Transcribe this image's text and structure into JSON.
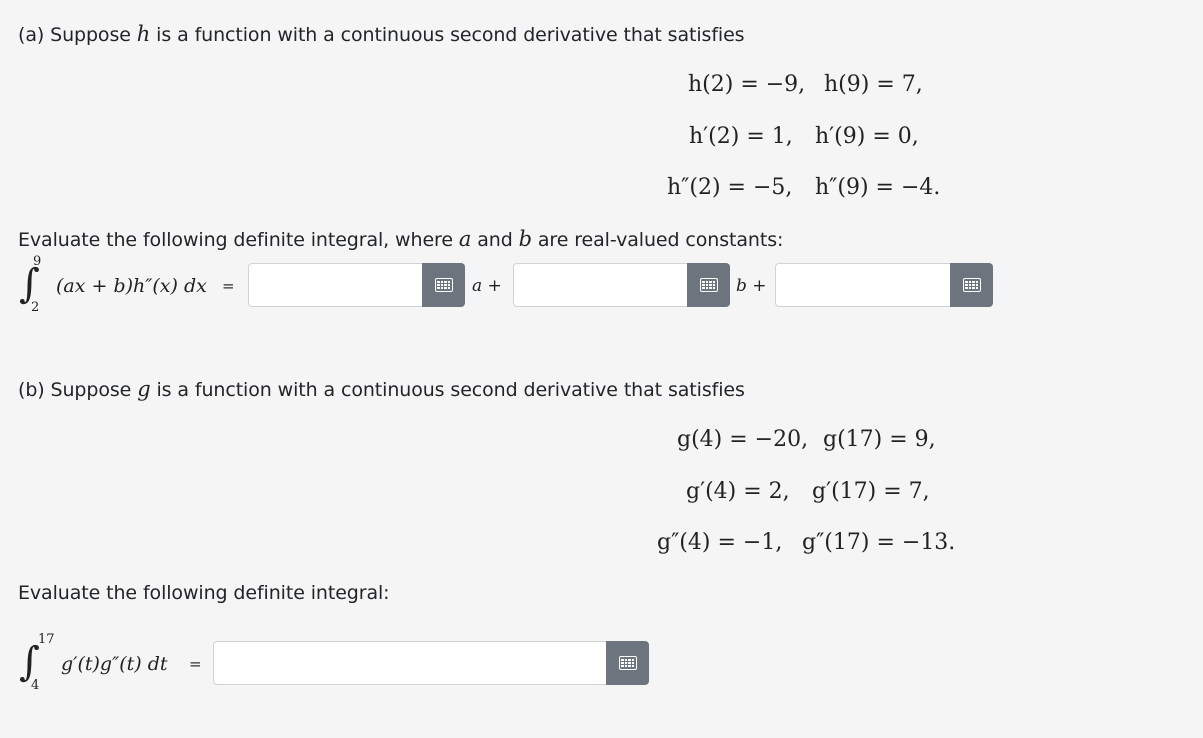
{
  "part_a": {
    "intro_prefix": "(a) Suppose ",
    "intro_var": "h",
    "intro_suffix": " is a function with a continuous second derivative that satisfies",
    "conditions": [
      {
        "left": "h(2) = −9,",
        "right": "h(9) = 7,"
      },
      {
        "left": "h′(2) = 1,",
        "right": "h′(9) = 0,"
      },
      {
        "left": "h″(2) = −5,",
        "right": "h″(9) = −4."
      }
    ],
    "evaluate_prefix": "Evaluate the following definite integral, where ",
    "evaluate_a": "a",
    "evaluate_mid": " and ",
    "evaluate_b": "b",
    "evaluate_suffix": " are real-valued constants:",
    "integral": {
      "upper": "9",
      "lower": "2",
      "integrand": "(ax + b)h″(x) dx",
      "equals": "="
    },
    "inputs": [
      {
        "value": "",
        "after": "a +"
      },
      {
        "value": "",
        "after": "b +"
      },
      {
        "value": "",
        "after": ""
      }
    ]
  },
  "part_b": {
    "intro_prefix": "(b) Suppose ",
    "intro_var": "g",
    "intro_suffix": " is a function with a continuous second derivative that satisfies",
    "conditions": [
      {
        "left": "g(4) = −20,",
        "right": "g(17) = 9,"
      },
      {
        "left": "g′(4) = 2,",
        "right": "g′(17) = 7,"
      },
      {
        "left": "g″(4) = −1,",
        "right": "g″(17) = −13."
      }
    ],
    "evaluate_text": "Evaluate the following definite integral:",
    "integral": {
      "upper": "17",
      "lower": "4",
      "integrand": "g′(t)g″(t) dt",
      "equals": "="
    },
    "input": {
      "value": ""
    }
  },
  "icons": {
    "keyboard": "keyboard-icon"
  },
  "colors": {
    "button": "#6c757d",
    "background": "#f5f5f5"
  }
}
